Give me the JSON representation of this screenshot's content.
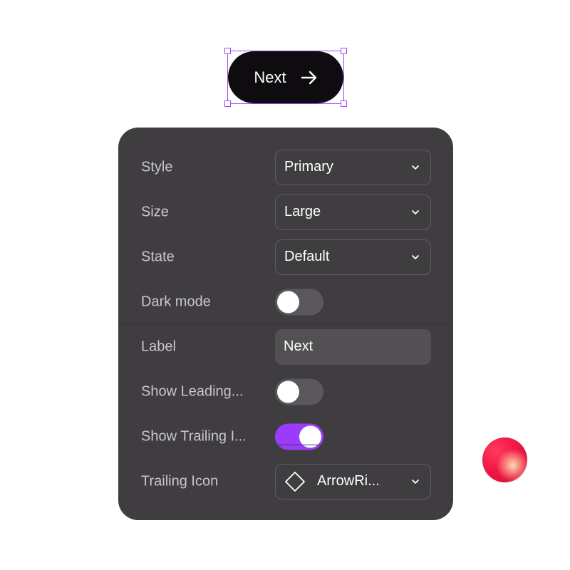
{
  "preview": {
    "button_label": "Next",
    "trailing_icon": "arrow-right-icon"
  },
  "panel": {
    "style": {
      "label": "Style",
      "value": "Primary"
    },
    "size": {
      "label": "Size",
      "value": "Large"
    },
    "state": {
      "label": "State",
      "value": "Default"
    },
    "dark_mode": {
      "label": "Dark mode",
      "on": false
    },
    "label_field": {
      "label": "Label",
      "value": "Next"
    },
    "show_leading": {
      "label": "Show Leading...",
      "on": false
    },
    "show_trailing": {
      "label": "Show Trailing I...",
      "on": true
    },
    "trailing_icon": {
      "label": "Trailing Icon",
      "value": "ArrowRi...",
      "icon": "diamond-icon"
    }
  },
  "colors": {
    "accent": "#9b3cfc",
    "selection": "#9b4dff",
    "panel_bg": "#3f3d40",
    "button_bg": "#0f0c10"
  }
}
